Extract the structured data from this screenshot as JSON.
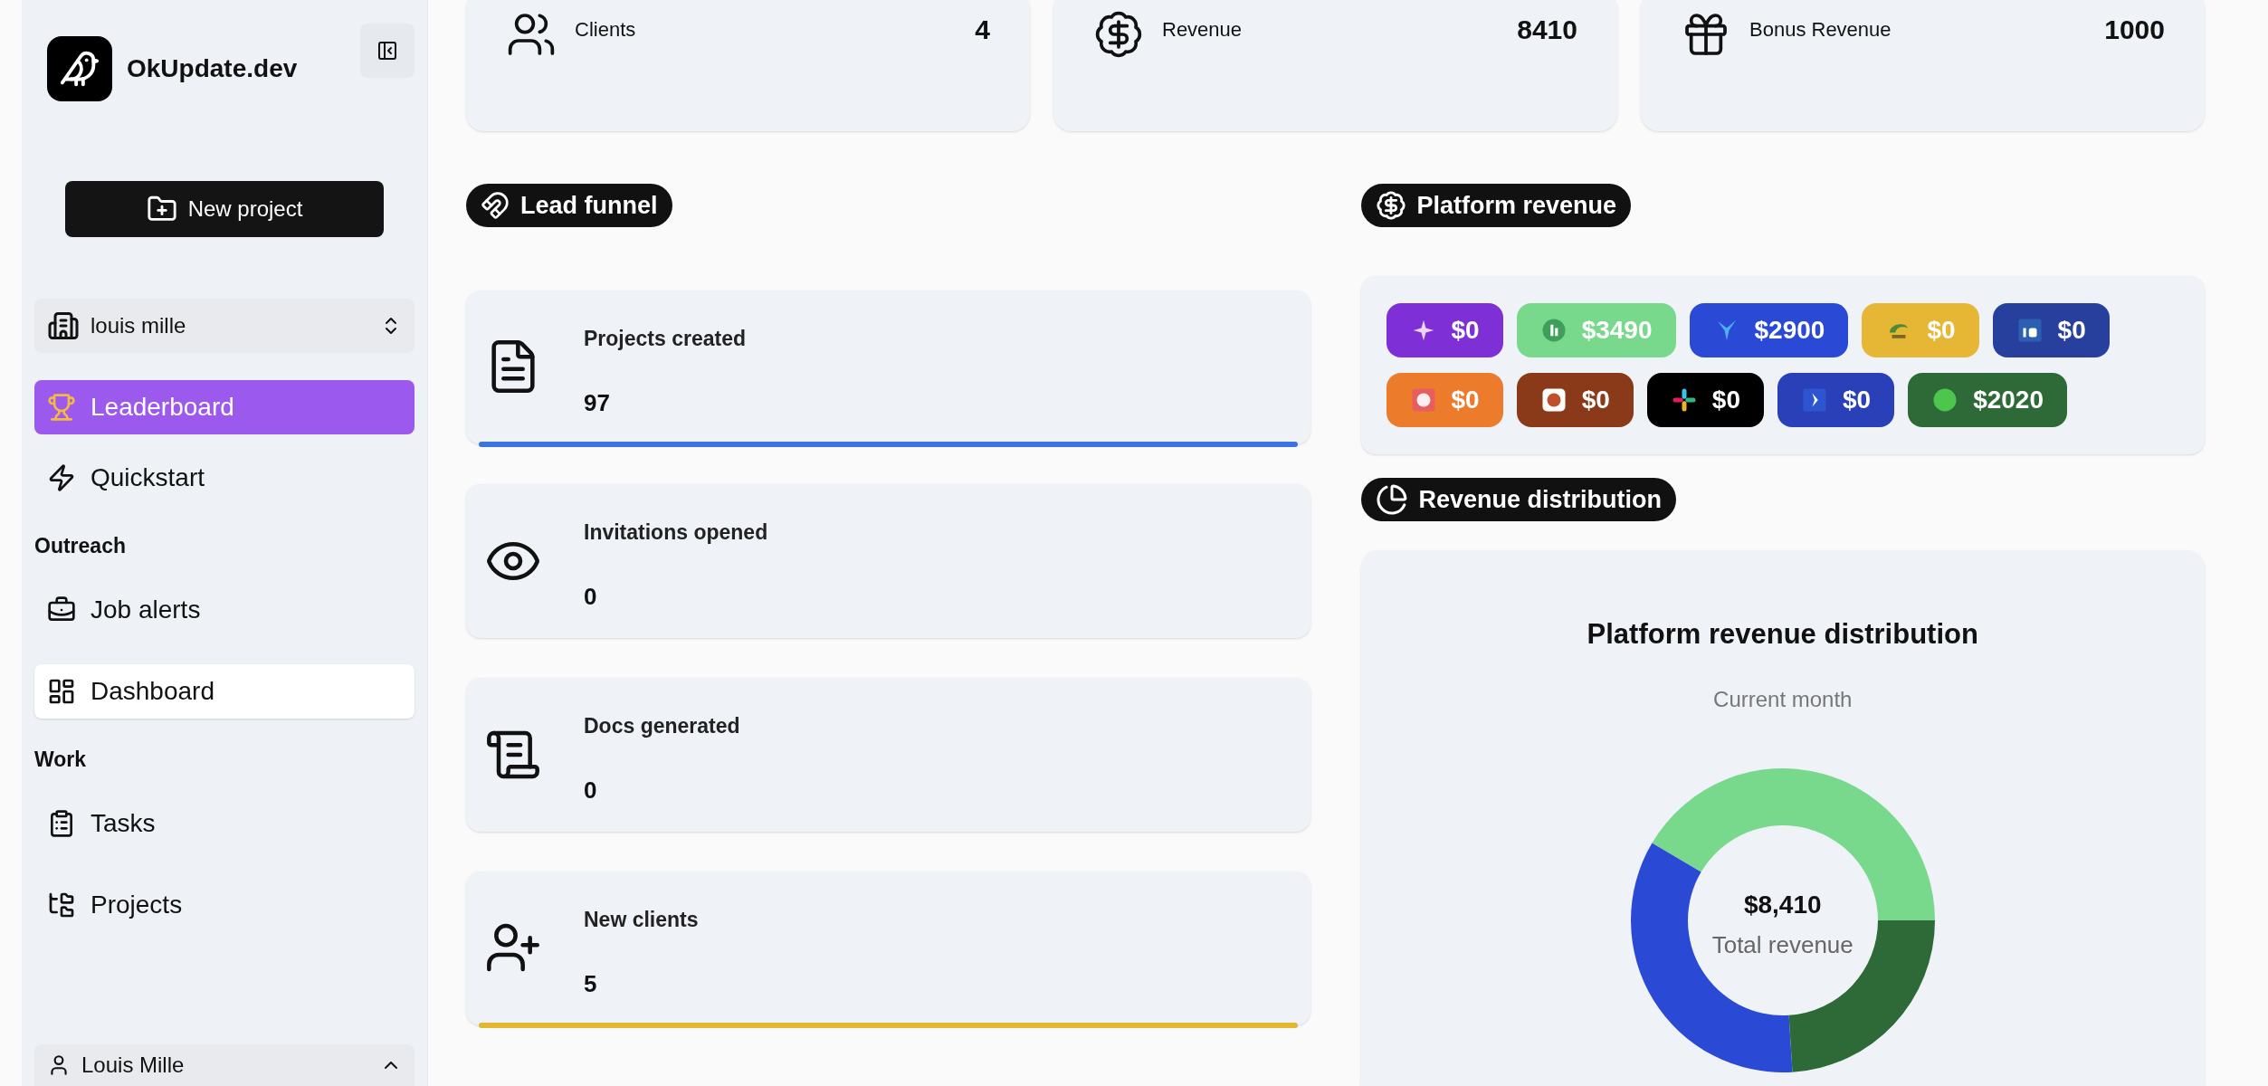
{
  "sidebar": {
    "brand": "OkUpdate.dev",
    "new_project_button": "New project",
    "workspace": "louis mille",
    "groups": [
      {
        "items": [
          {
            "label": "Leaderboard",
            "selected": true,
            "hovered": false
          },
          {
            "label": "Quickstart",
            "selected": false,
            "hovered": false
          }
        ]
      },
      {
        "heading": "Outreach",
        "items": [
          {
            "label": "Job alerts",
            "selected": false,
            "hovered": false
          },
          {
            "label": "Dashboard",
            "selected": false,
            "hovered": true
          }
        ]
      },
      {
        "heading": "Work",
        "items": [
          {
            "label": "Tasks",
            "selected": false,
            "hovered": false
          },
          {
            "label": "Projects",
            "selected": false,
            "hovered": false
          }
        ]
      }
    ],
    "user": "Louis Mille"
  },
  "stat_cards": [
    {
      "label": "Clients",
      "value": "4"
    },
    {
      "label": "Revenue",
      "value": "8410"
    },
    {
      "label": "Bonus Revenue",
      "value": "1000"
    }
  ],
  "lead_funnel": {
    "title": "Lead funnel",
    "cards": [
      {
        "label": "Projects created",
        "value": "97",
        "color": "#3b73e0"
      },
      {
        "label": "Invitations opened",
        "value": "0"
      },
      {
        "label": "Docs generated",
        "value": "0"
      },
      {
        "label": "New clients",
        "value": "5",
        "color": "#e2b731"
      }
    ]
  },
  "platform_revenue": {
    "title": "Platform revenue",
    "chips": [
      {
        "amount": "$0",
        "color": "#7e2fd6"
      },
      {
        "amount": "$3490",
        "color": "#78d98c"
      },
      {
        "amount": "$2900",
        "color": "#2a4ad6"
      },
      {
        "amount": "$0",
        "color": "#e6b735"
      },
      {
        "amount": "$0",
        "color": "#27409e"
      },
      {
        "amount": "$0",
        "color": "#ec7b2c"
      },
      {
        "amount": "$0",
        "color": "#8b3a19"
      },
      {
        "amount": "$0",
        "color": "#000000"
      },
      {
        "amount": "$0",
        "color": "#2a40b8"
      },
      {
        "amount": "$2020",
        "color": "#2e6a37"
      }
    ]
  },
  "revenue_distribution": {
    "title": "Revenue distribution",
    "subtitle": "Current month",
    "total": "$8,410",
    "total_label": "Total revenue",
    "chart_data": {
      "type": "donut",
      "title": "Platform revenue distribution",
      "values": [
        41.5,
        34.5,
        24.0
      ],
      "colors": [
        "#78d98c",
        "#2a4ad6",
        "#2e6a37"
      ]
    }
  }
}
